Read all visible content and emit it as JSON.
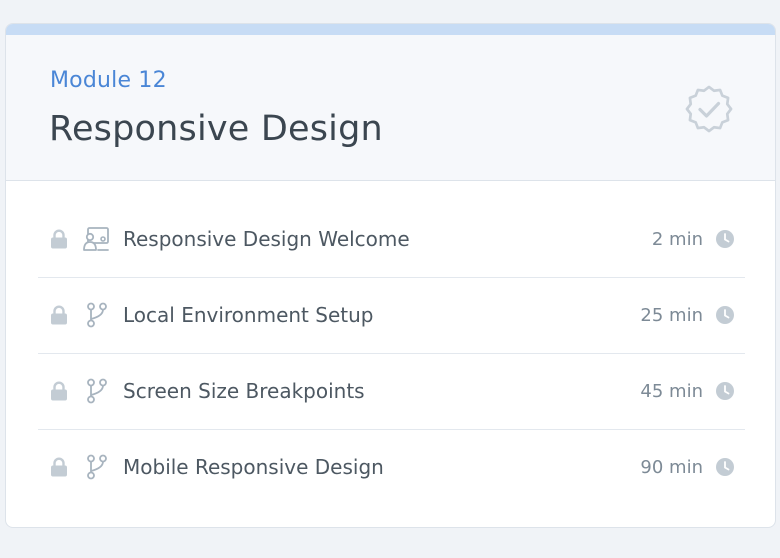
{
  "module": {
    "label": "Module 12",
    "title": "Responsive Design",
    "status_icon": "check-badge-icon"
  },
  "lessons": [
    {
      "title": "Responsive Design Welcome",
      "duration": "2 min",
      "type_icon": "presentation-icon",
      "locked": true
    },
    {
      "title": "Local Environment Setup",
      "duration": "25 min",
      "type_icon": "git-branch-icon",
      "locked": true
    },
    {
      "title": "Screen Size Breakpoints",
      "duration": "45 min",
      "type_icon": "git-branch-icon",
      "locked": true
    },
    {
      "title": "Mobile Responsive Design",
      "duration": "90 min",
      "type_icon": "git-branch-icon",
      "locked": true
    }
  ],
  "colors": {
    "accent": "#4a86d6",
    "top_bar": "#c7dcf5",
    "icon_gray": "#b8c2cc"
  }
}
